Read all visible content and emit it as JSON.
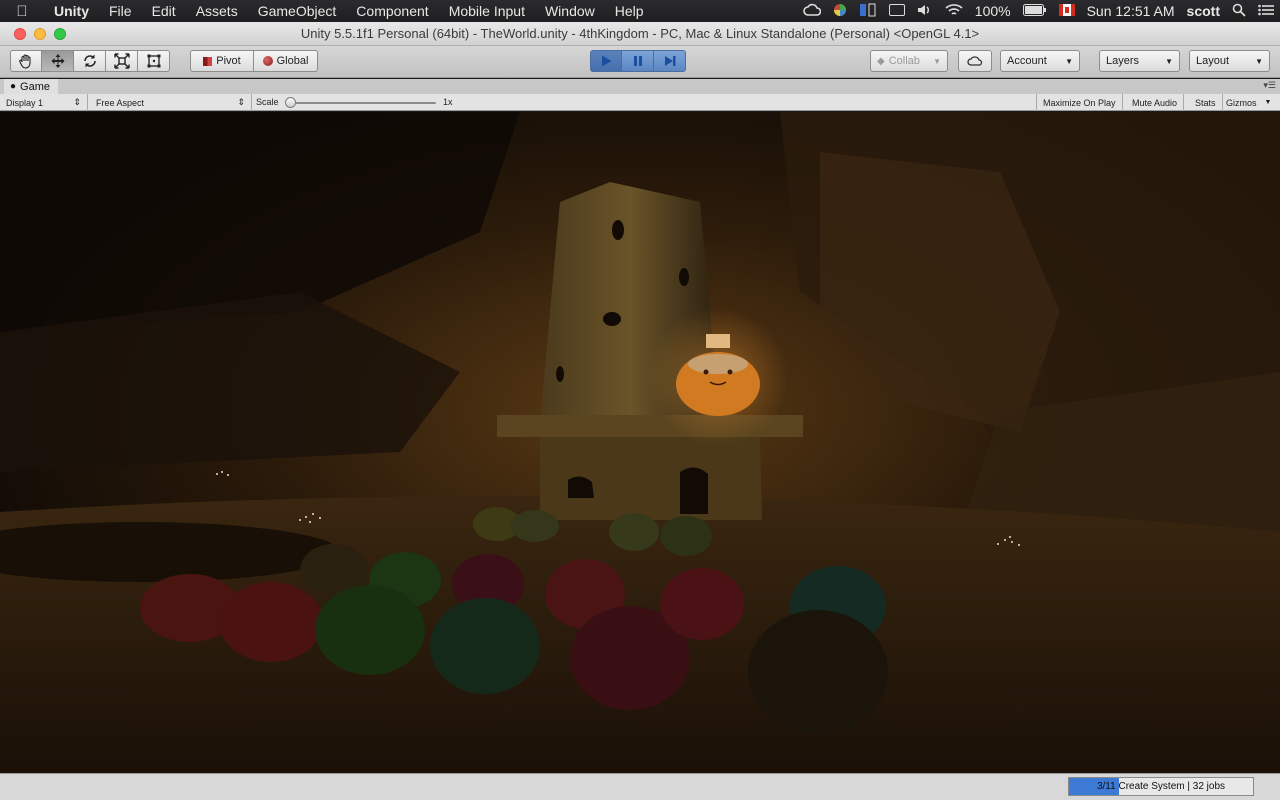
{
  "menubar": {
    "apple_icon": "apple-logo-icon",
    "items": [
      "Unity",
      "File",
      "Edit",
      "Assets",
      "GameObject",
      "Component",
      "Mobile Input",
      "Window",
      "Help"
    ],
    "battery_percent": "100%",
    "clock": "Sun 12:51 AM",
    "user": "scott"
  },
  "window": {
    "title": "Unity 5.5.1f1 Personal (64bit) - TheWorld.unity - 4thKingdom - PC, Mac & Linux Standalone (Personal) <OpenGL 4.1>"
  },
  "toolbar": {
    "tools": [
      "hand-tool-icon",
      "move-tool-icon",
      "rotate-tool-icon",
      "scale-tool-icon",
      "rect-tool-icon"
    ],
    "pivot_label": "Pivot",
    "global_label": "Global",
    "collab_label": "Collab",
    "account_label": "Account",
    "layers_label": "Layers",
    "layout_label": "Layout",
    "playing": true
  },
  "game_panel": {
    "tab_label": "Game",
    "display_label": "Display 1",
    "aspect_label": "Free Aspect",
    "scale_label": "Scale",
    "scale_value": "1x",
    "scale_fraction": 0.0,
    "maximize_label": "Maximize On Play",
    "mute_label": "Mute Audio",
    "stats_label": "Stats",
    "gizmos_label": "Gizmos"
  },
  "status": {
    "progress_text": "3/11 Create System | 32 jobs",
    "progress_fraction": 0.27
  },
  "colors": {
    "accent_blue": "#3c7ad6",
    "play_blue": "#5b86c3"
  }
}
